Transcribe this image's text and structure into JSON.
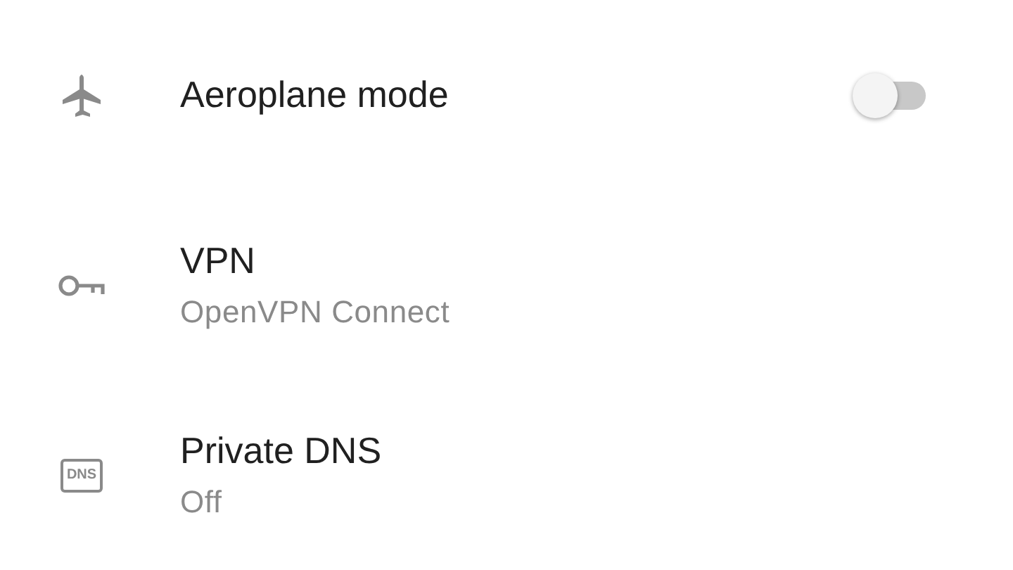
{
  "settings": [
    {
      "kind": "toggle",
      "title": "Aeroplane mode",
      "on": false
    },
    {
      "kind": "detail",
      "title": "VPN",
      "subtitle": "OpenVPN Connect"
    },
    {
      "kind": "detail",
      "icon_text": "DNS",
      "title": "Private DNS",
      "subtitle": "Off"
    }
  ]
}
